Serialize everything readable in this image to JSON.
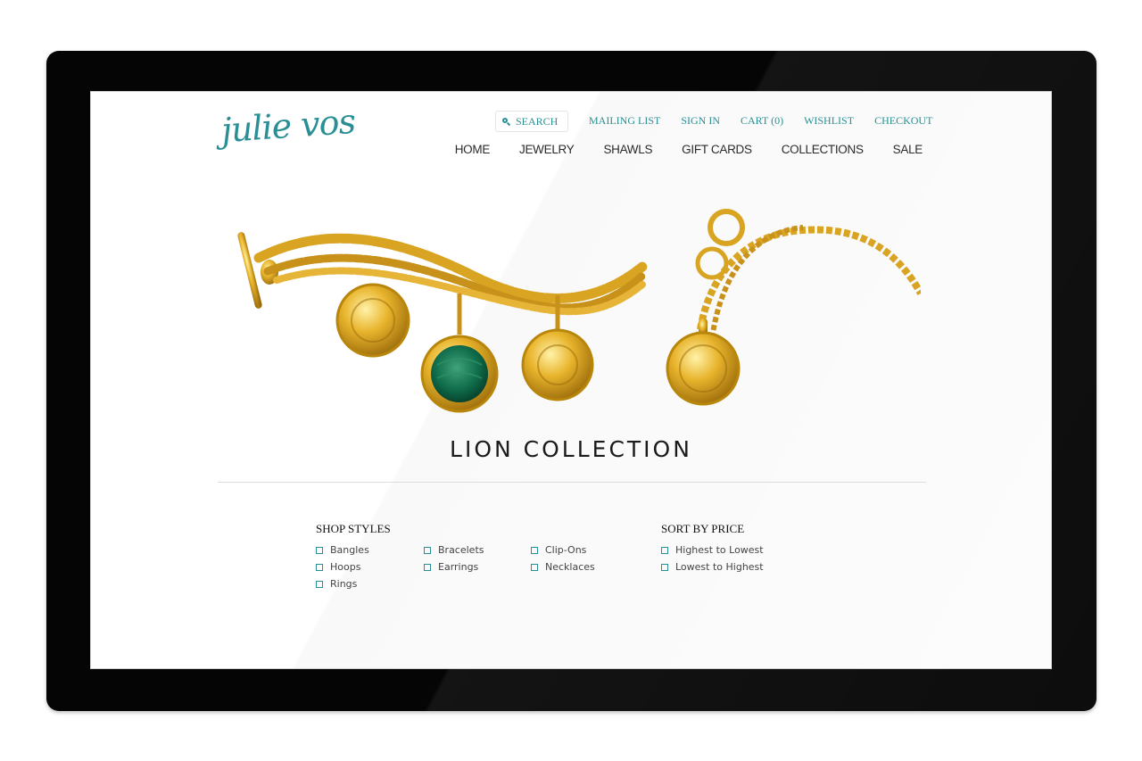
{
  "brand": {
    "logo_text": "julie vos"
  },
  "search": {
    "placeholder": "SEARCH"
  },
  "top_links": [
    "MAILING LIST",
    "SIGN IN",
    "CART (0)",
    "WISHLIST",
    "CHECKOUT"
  ],
  "main_nav": [
    "HOME",
    "JEWELRY",
    "SHAWLS",
    "GIFT CARDS",
    "COLLECTIONS",
    "SALE"
  ],
  "page": {
    "title": "LION COLLECTION"
  },
  "filters": {
    "shop_styles": {
      "heading": "SHOP STYLES",
      "options": [
        "Bangles",
        "Hoops",
        "Rings",
        "Bracelets",
        "Earrings",
        "Clip-Ons",
        "Necklaces"
      ]
    },
    "sort_by_price": {
      "heading": "SORT BY PRICE",
      "options": [
        "Highest to Lowest",
        "Lowest to Highest"
      ]
    }
  },
  "colors": {
    "accent": "#2a8f95",
    "gold": "#d9a422",
    "malachite": "#0f6b4a"
  }
}
